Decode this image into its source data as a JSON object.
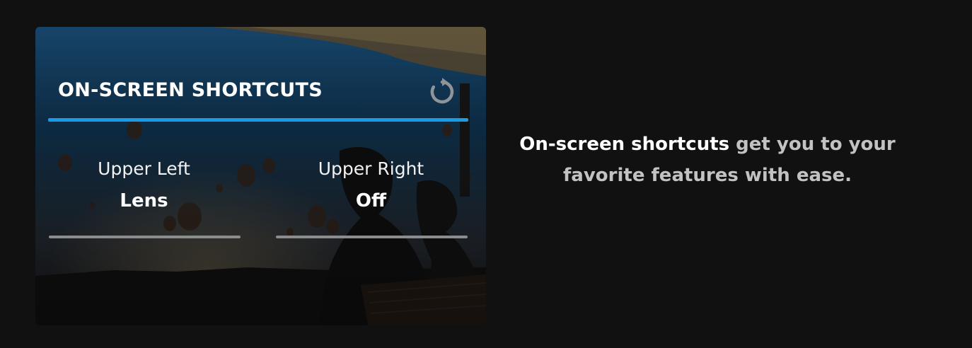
{
  "shortcuts_panel": {
    "title": "ON-SCREEN SHORTCUTS",
    "reset_icon": "reset-rotate-icon",
    "accent_color": "#1a9be6",
    "slots": [
      {
        "label": "Upper Left",
        "value": "Lens"
      },
      {
        "label": "Upper Right",
        "value": "Off"
      }
    ]
  },
  "caption": {
    "lead": "On-screen shortcuts",
    "rest": "get you to your favorite features with ease."
  }
}
